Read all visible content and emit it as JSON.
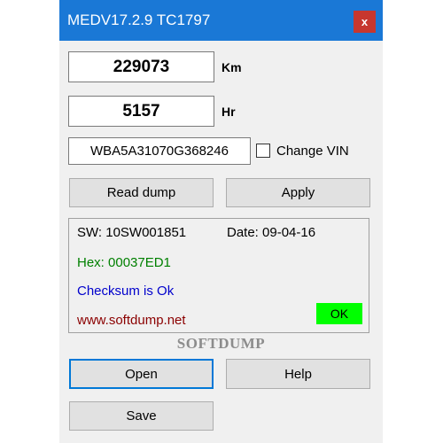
{
  "window": {
    "title": "MEDV17.2.9 TC1797",
    "close_glyph": "x"
  },
  "odometer": {
    "km_value": "229073",
    "km_label": "Km",
    "hr_value": "5157",
    "hr_label": "Hr"
  },
  "vin": {
    "value": "WBA5A31070G368246",
    "change_label": "Change VIN",
    "change_checked": false
  },
  "actions": {
    "read_dump": "Read dump",
    "apply": "Apply",
    "open": "Open",
    "help": "Help",
    "save": "Save"
  },
  "info": {
    "sw": "SW: 10SW001851",
    "date": "Date: 09-04-16",
    "hex": "Hex: 00037ED1",
    "checksum": "Checksum is Ok",
    "website": "www.softdump.net",
    "status": "OK"
  },
  "brand": "SOFTDUMP",
  "colors": {
    "titlebar": "#1a78d6",
    "close": "#c7372f",
    "hex_text": "#008000",
    "checksum_text": "#0000cc",
    "website_text": "#8b0000",
    "status_bg": "#00ff00",
    "focus_border": "#0078d7"
  },
  "icons": {
    "close": "close-icon",
    "checkbox": "checkbox-icon"
  }
}
